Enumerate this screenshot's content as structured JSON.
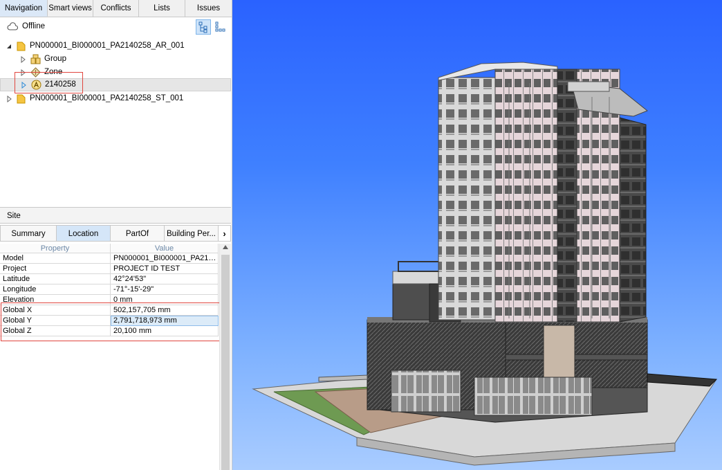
{
  "tabs": [
    "Navigation",
    "Smart views",
    "Conflicts",
    "Lists",
    "Issues"
  ],
  "status": {
    "label": "Offline"
  },
  "tree": {
    "items": [
      {
        "label": "PN000001_BI000001_PA2140258_AR_001",
        "icon": "model-file-icon",
        "expanded": true
      },
      {
        "label": "Group",
        "icon": "group-icon"
      },
      {
        "label": "Zone",
        "icon": "zone-icon"
      },
      {
        "label": "2140258",
        "icon": "site-icon",
        "selected": true
      },
      {
        "label": "PN000001_BI000001_PA2140258_ST_001",
        "icon": "model-file-icon",
        "expanded": false
      }
    ]
  },
  "panel": {
    "title": "Site",
    "subtabs": [
      "Summary",
      "Location",
      "PartOf",
      "Building Per..."
    ],
    "active_subtab": "Location",
    "columns": [
      "Property",
      "Value"
    ],
    "rows": [
      {
        "property": "Model",
        "value": "PN000001_BI000001_PA214..."
      },
      {
        "property": "Project",
        "value": "PROJECT ID TEST"
      },
      {
        "property": "Latitude",
        "value": "42°24'53\""
      },
      {
        "property": "Longitude",
        "value": "-71°-15'-29\""
      },
      {
        "property": "Elevation",
        "value": "0 mm"
      },
      {
        "property": "Global X",
        "value": "502,157,705 mm"
      },
      {
        "property": "Global Y",
        "value": "2,791,718,973 mm"
      },
      {
        "property": "Global Z",
        "value": "20,100 mm"
      }
    ]
  },
  "colors": {
    "accent": "#dbe8f7",
    "highlight": "#e0453e",
    "sky_top": "#2a62ff",
    "sky_bottom": "#a9ccff"
  }
}
